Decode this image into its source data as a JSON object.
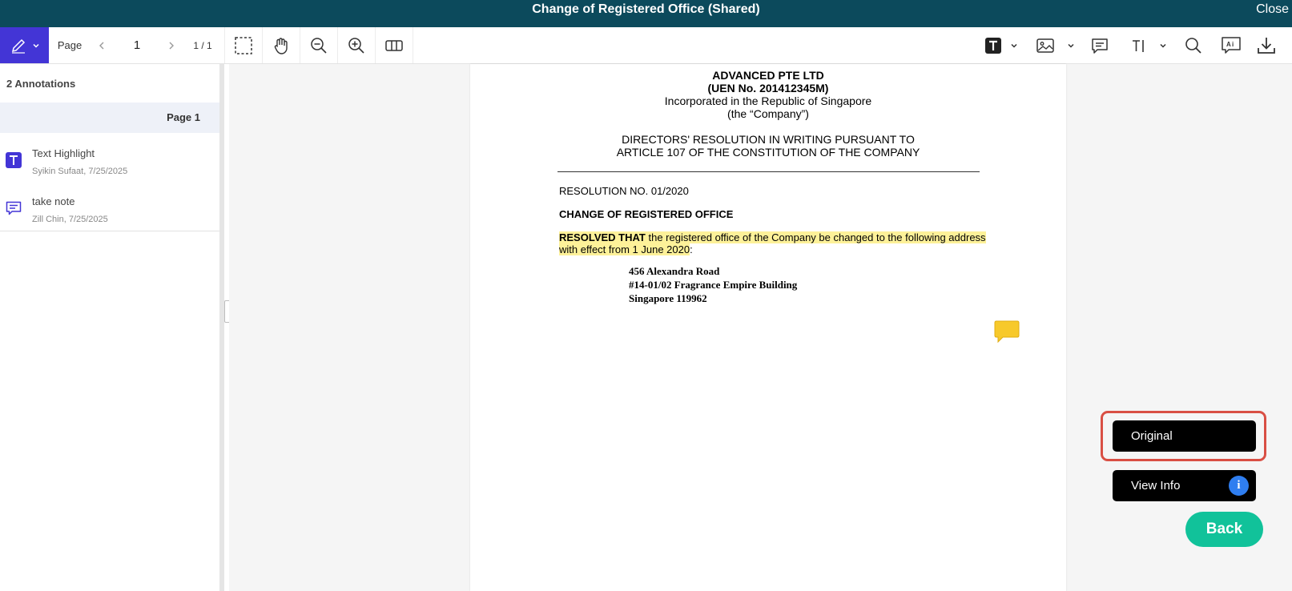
{
  "window": {
    "title": "Change of Registered Office (Shared)",
    "close_label": "Close"
  },
  "toolbar": {
    "page_label": "Page",
    "page_value": "1",
    "page_total": "1 / 1",
    "icons": [
      "pen-icon",
      "chevron-down-icon",
      "chevron-left-icon",
      "chevron-right-icon",
      "marquee-select-icon",
      "hand-pan-icon",
      "zoom-out-icon",
      "zoom-in-icon",
      "columns-icon",
      "text-tool-icon",
      "image-icon",
      "comment-icon",
      "text-cursor-icon",
      "search-icon",
      "ai-icon",
      "download-icon"
    ],
    "accent": "#4335d6"
  },
  "sidebar": {
    "header": "2 Annotations",
    "page_group": "Page 1",
    "annotations": [
      {
        "name": "Text Highlight",
        "meta": "Syikin Sufaat, 7/25/2025",
        "icon": "text-highlight-icon"
      },
      {
        "name": "take note",
        "meta": "Zill Chin, 7/25/2025",
        "icon": "comment-icon"
      }
    ]
  },
  "document": {
    "company": "ADVANCED PTE LTD",
    "uen": "(UEN No. 201412345M)",
    "incorporated": "Incorporated in the Republic of Singapore",
    "company_alias": "(the “Company”)",
    "heading_line1": "DIRECTORS' RESOLUTION IN WRITING PURSUANT TO",
    "heading_line2": "ARTICLE 107 OF THE CONSTITUTION OF THE COMPANY",
    "resolution_no": "RESOLUTION NO. 01/2020",
    "subject": "CHANGE OF REGISTERED OFFICE",
    "resolved_bold": "RESOLVED THAT",
    "resolved_line1_rest": " the registered office of the Company be changed to the following address",
    "resolved_line2": "with effect from 1 June 2020",
    "resolved_line2_end": ":",
    "address_line1": "456 Alexandra Road",
    "address_line2": "#14-01/02 Fragrance Empire Building",
    "address_line3": "Singapore 119962",
    "highlight_color": "#fdf199",
    "note_color": "#f7c92b"
  },
  "actions": {
    "original_label": "Original",
    "view_info_label": "View Info",
    "info_glyph": "i",
    "back_label": "Back",
    "back_color": "#11c29a"
  }
}
